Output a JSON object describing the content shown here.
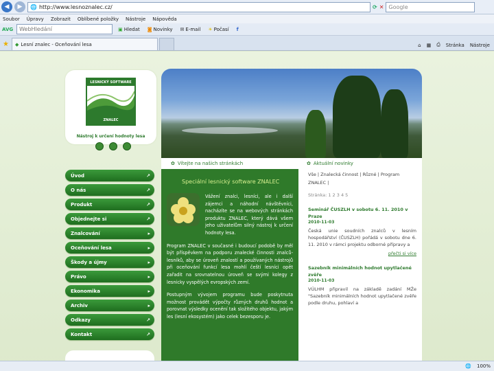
{
  "browser": {
    "url": "http://www.lesnoznalec.cz/",
    "search_placeholder": "Google",
    "menu": [
      "Soubor",
      "Úpravy",
      "Zobrazit",
      "Oblíbené položky",
      "Nástroje",
      "Nápověda"
    ],
    "toolbar": {
      "avg": "AVG",
      "search_hint": "WebHledání",
      "find": "Hledat",
      "news": "Novinky",
      "email": "E-mail",
      "weather": "Počasí"
    },
    "tab_title": "Lesní znalec - Oceňování lesa",
    "right_tools": {
      "page": "Stránka",
      "tools": "Nástroje"
    }
  },
  "site": {
    "logo_top": "LESNICKÝ SOFTWARE",
    "logo_bottom": "ZNALEC",
    "tagline": "Nástroj k určení hodnoty lesa",
    "nav": [
      "Úvod",
      "O nás",
      "Produkt",
      "Objednejte si",
      "Znalcování",
      "Oceňování lesa",
      "Škody a újmy",
      "Právo",
      "Ekonomika",
      "Archiv",
      "Odkazy",
      "Kontakt"
    ],
    "welcome": "Vítejte na našich stránkách",
    "news_title": "Aktuální novinky",
    "heading": "Speciální lesnický software ZNALEC",
    "intro": "Vážení znalci, lesníci, ale i další zájemci a náhodní návštěvníci, nacházíte se na webových stránkách produktu ZNALEC, který dává všem jeho uživatelům silný nástroj k určení hodnoty lesa.",
    "intro_tail": "uživatelům silný nástroj k určení hodnoty lesa.",
    "para2": "Program ZNALEC v současné i budoucí podobě by měl být příspěvkem na podporu znalecké činnosti znalců-lesníků, aby se úroveň znalostí a používaných nástrojů při oceňování funkcí lesa mohlí čeští lesníci opět zařadit na srovnatelnou úroveň se svými kolegy z lesnicky vyspělých evropských zemí.",
    "para3": "Postupným vývojem programu bude poskytnuta možnost provádět výpočty různých druhů hodnot a porovnat výsledky ocenění tak složitého objektu, jakým les (lesní ekosystém) jako celek bezesporu je.",
    "filter": "Vše | Znalecká činnost | Různé | Program ZNALEC |",
    "page_label": "Stránka: 1 2 3 4 5",
    "news1_title": "Seminář ČUSZLH v sobotu 6. 11. 2010 v Praze",
    "news1_date": "2010-11-03",
    "news1_text": "Česká unie soudních znalců v lesním hospodářství (ČUSZLH) pořádá v sobotu dne 6. 11. 2010 v rámci projektu odborné přípravy a",
    "news1_more": "přečti si více",
    "news2_title": "Sazebník minimálních hodnot upytlačené zvěře",
    "news2_date": "2010-11-03",
    "news2_text": "VÚLHM připravil na základě zadání MŽe \"Sazebník minimálních hodnot upytlačené zvěře podle druhu, pohlaví a"
  },
  "status": {
    "zoom": "100%"
  }
}
